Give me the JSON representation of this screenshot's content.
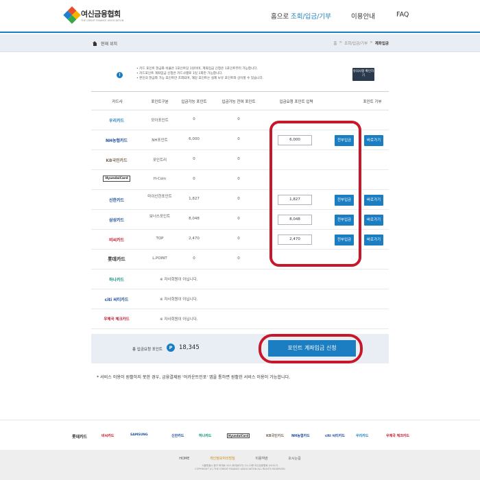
{
  "header": {
    "logo_title": "여신금융협회",
    "logo_sub": "THE CREDIT FINANCE ASSOCIATION",
    "nav": [
      "홈으로",
      "조회/입금/기부",
      "이용안내",
      "FAQ"
    ]
  },
  "locbar": {
    "label": "현재 위치",
    "crumbs": [
      "홈",
      ">",
      "조회/입금/기부",
      ">",
      "계좌입금"
    ]
  },
  "notice": {
    "lines": [
      "• 카드 포인트 현금화 비율은 1포인트당 1원이며, 계좌입금 신청은 1포인트부터 가능합니다.",
      "• 카드포인트 계좌입금 신청은 카드사별로 1일 1회만 가능합니다.",
      "• 본인의 현금화 가능 포인트만 조회되며, 해당 포인트는 실제 보유 포인트와 상이할 수 있습니다."
    ],
    "button": "유의사항 확인하기"
  },
  "table": {
    "headers": [
      "카드사",
      "포인트구분",
      "입금가능 포인트",
      "입금가능 잔여 포인트",
      "입금요청 포인트 입력",
      "포인트 기부"
    ],
    "rows": [
      {
        "card": "우리카드",
        "type": "모아포인트",
        "avail": "0",
        "remain": "0"
      },
      {
        "card": "NH농협카드",
        "type": "NH포인트",
        "avail": "6,000",
        "remain": "0",
        "input": "6,000"
      },
      {
        "card": "KB국민카드",
        "type": "포인트리",
        "avail": "0",
        "remain": "0"
      },
      {
        "card": "HyundaiCard",
        "type": "H-Coin",
        "avail": "0",
        "remain": "0"
      },
      {
        "card": "신한카드",
        "type": "마이신한포인트",
        "avail": "1,827",
        "remain": "0",
        "input": "1,827"
      },
      {
        "card": "삼성카드",
        "type": "보너스포인트",
        "avail": "8,048",
        "remain": "0",
        "input": "8,048"
      },
      {
        "card": "비씨카드",
        "type": "TOP",
        "avail": "2,470",
        "remain": "0",
        "input": "2,470"
      },
      {
        "card": "롯데카드",
        "type": "L.POINT",
        "avail": "0",
        "remain": "0"
      },
      {
        "card": "하나카드",
        "note": "※ 자사회원이 아닙니다."
      },
      {
        "card": "citi 씨티카드",
        "note": "※ 자사회원이 아닙니다."
      },
      {
        "card": "우체국 체크카드",
        "note": "※ 자사회원이 아닙니다."
      }
    ],
    "btn_all": "전부입금",
    "btn_go": "바로가기"
  },
  "total": {
    "label": "총 입금요청 포인트",
    "badge": "P",
    "value": "18,345",
    "apply": "포인트 계좌입금 신청"
  },
  "footnote": "* 서비스 이용이 원활하지 못한 경우, 금융결제원 '어카운트인포' 앱을 통하면 원활한 서비스 이용이 가능합니다.",
  "partners": [
    "롯데카드",
    "비씨카드",
    "SAMSUNG",
    "신한카드",
    "하나카드",
    "HyundaiCard",
    "KB국민카드",
    "NH농협카드",
    "citi 씨티카드",
    "우리카드",
    "우체국 체크카드"
  ],
  "footer": {
    "links": [
      "HOME",
      "개인정보처리방침",
      "이용약관",
      "오시는길"
    ],
    "addr1": "서울특별시 중구 퇴계로 410 (퇴계로5가) 12-13층 여신금융협회 (04517)",
    "addr2": "COPYRIGHT (C) THE CREDIT FINANCE ASSOCIATION ALL RIGHTS RESERVED"
  },
  "colors": {
    "accent": "#1b7ec2",
    "highlight": "#c7172b"
  }
}
